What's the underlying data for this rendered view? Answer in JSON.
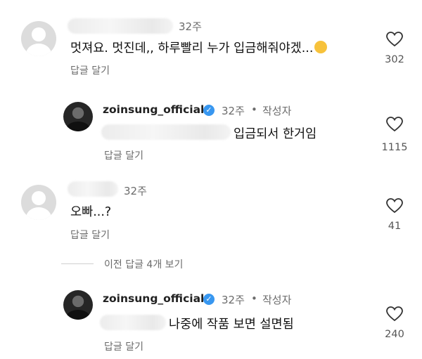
{
  "comments": [
    {
      "time": "32주",
      "text": "멋져요. 멋진데,, 하루빨리 누가 입금해줘야겠...",
      "emoji": "😂",
      "reply_label": "답글 달기",
      "likes": "302"
    },
    {
      "username": "zoinsung_official",
      "time": "32주",
      "dot": "•",
      "author_tag": "작성자",
      "text": "입금되서 한거임",
      "reply_label": "답글 달기",
      "likes": "1115"
    },
    {
      "time": "32주",
      "text": "오빠...?",
      "reply_label": "답글 달기",
      "likes": "41"
    },
    {
      "username": "zoinsung_official",
      "time": "32주",
      "dot": "•",
      "author_tag": "작성자",
      "text": "나중에 작품 보면 설면됨",
      "reply_label": "답글 달기",
      "likes": "240"
    }
  ],
  "view_previous_replies": "이전 답글 4개 보기",
  "icons": {
    "heart": "heart-outline-icon",
    "verified": "verified-badge-icon",
    "verified_color": "#3897f0"
  }
}
